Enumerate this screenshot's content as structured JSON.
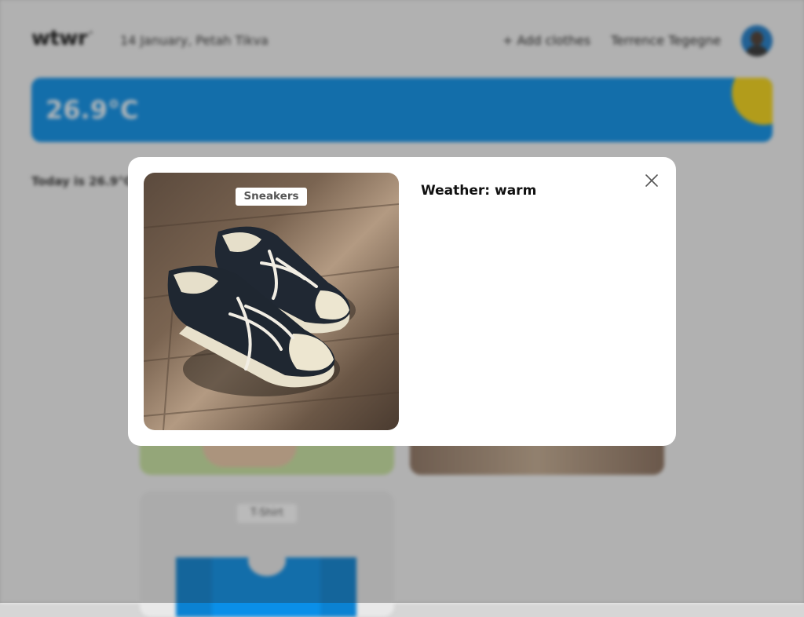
{
  "header": {
    "logo": "wtwr",
    "logo_mark": "°",
    "date_location": "14 January, Petah Tikva",
    "add_clothes": "+ Add clothes",
    "user_name": "Terrence Tegegne"
  },
  "weather": {
    "temperature": "26.9°C"
  },
  "main": {
    "today_text": "Today is 26.9°C"
  },
  "cards": [
    {
      "label": "T-Shirt"
    }
  ],
  "modal": {
    "item_tag": "Sneakers",
    "weather_label": "Weather: warm",
    "close_icon": "close-icon"
  },
  "colors": {
    "weather_bar": "#0a8fe8",
    "sun": "#f4d316",
    "overlay": "rgba(40,40,40,0.32)"
  }
}
